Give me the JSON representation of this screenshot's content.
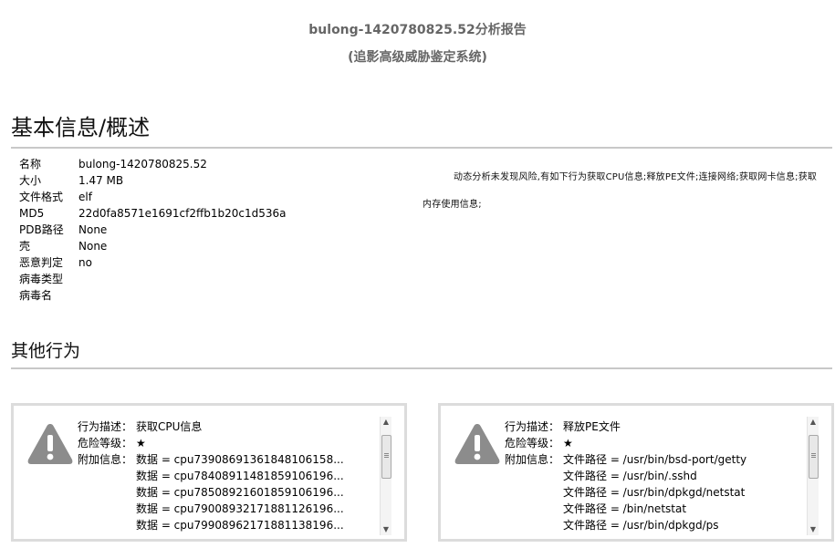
{
  "report": {
    "title": "bulong-1420780825.52分析报告",
    "subtitle": "(追影高级威胁鉴定系统)"
  },
  "basic_info": {
    "heading": "基本信息/概述",
    "rows": [
      {
        "label": "名称",
        "value": "bulong-1420780825.52"
      },
      {
        "label": "大小",
        "value": "1.47 MB"
      },
      {
        "label": "文件格式",
        "value": "elf"
      },
      {
        "label": "MD5",
        "value": "22d0fa8571e1691cf2ffb1b20c1d536a"
      },
      {
        "label": "PDB路径",
        "value": "None"
      },
      {
        "label": "壳",
        "value": "None"
      },
      {
        "label": "恶意判定",
        "value": "no"
      },
      {
        "label": "病毒类型",
        "value": ""
      },
      {
        "label": "病毒名",
        "value": ""
      }
    ],
    "analysis_note": "动态分析未发现风险,有如下行为获取CPU信息;释放PE文件;连接网络;获取网卡信息;获取内存使用信息;"
  },
  "other_behaviors": {
    "heading": "其他行为",
    "cards": [
      {
        "lines": [
          {
            "k": "行为描述：",
            "v": "获取CPU信息"
          },
          {
            "k": "危险等级：",
            "v": "★"
          },
          {
            "k": "附加信息：",
            "v": "数据 = cpu7390869136184810615​8..."
          },
          {
            "k": "",
            "v": "数据 = cpu7840891148185910619​6..."
          },
          {
            "k": "",
            "v": "数据 = cpu7850892160185910619​6..."
          },
          {
            "k": "",
            "v": "数据 = cpu7900893217188112619​6..."
          },
          {
            "k": "",
            "v": "数据 = cpu7990896217188113819​6..."
          }
        ]
      },
      {
        "lines": [
          {
            "k": "行为描述：",
            "v": "释放PE文件"
          },
          {
            "k": "危险等级：",
            "v": "★"
          },
          {
            "k": "附加信息：",
            "v": "文件路径 = /usr/bin/bsd-port/getty"
          },
          {
            "k": "",
            "v": "文件路径 = /usr/bin/.sshd"
          },
          {
            "k": "",
            "v": "文件路径 = /usr/bin/dpkgd/netstat"
          },
          {
            "k": "",
            "v": "文件路径 = /bin/netstat"
          },
          {
            "k": "",
            "v": "文件路径 = /usr/bin/dpkgd/ps"
          }
        ]
      }
    ]
  },
  "icons": {
    "warning": "warning-triangle-icon",
    "scroll_up": "scroll-up-arrow-icon",
    "scroll_down": "scroll-down-arrow-icon"
  },
  "colors": {
    "warning_icon": "#8c8c8c",
    "title_gray": "#666666",
    "divider": "#c8c8c8",
    "card_border": "#dcdcdc"
  }
}
